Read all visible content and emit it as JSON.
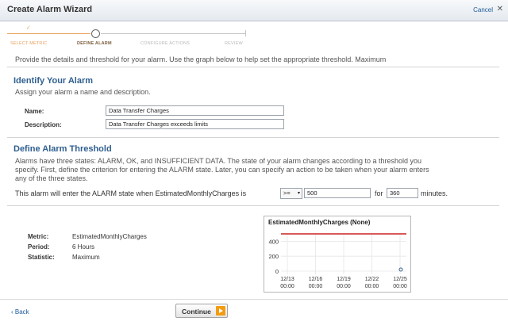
{
  "window": {
    "title": "Create Alarm Wizard",
    "cancel_label": "Cancel"
  },
  "steps": [
    {
      "label": "SELECT METRIC",
      "state": "done"
    },
    {
      "label": "DEFINE ALARM",
      "state": "active"
    },
    {
      "label": "CONFIGURE ACTIONS",
      "state": "pending"
    },
    {
      "label": "REVIEW",
      "state": "pending"
    }
  ],
  "intro": "Provide the details and threshold for your alarm. Use the graph below to help set the appropriate threshold. Maximum",
  "identify": {
    "title": "Identify Your Alarm",
    "desc": "Assign your alarm a name and description.",
    "name_label": "Name:",
    "name_value": "Data Transfer Charges",
    "description_label": "Description:",
    "description_value": "Data Transfer Charges exceeds limits"
  },
  "threshold": {
    "title": "Define Alarm Threshold",
    "desc_line1": "Alarms have three states: ALARM, OK, and INSUFFICIENT DATA. The state of your alarm changes according to a threshold you",
    "desc_line2": "specify. First, define the criterion for entering the ALARM state. Later, you can specify an action to be taken when your alarm enters",
    "desc_line3": "any of the three states.",
    "condition_text": "This alarm will enter the ALARM state when EstimatedMonthlyCharges is",
    "operator": ">=",
    "value": "500",
    "for_label": "for",
    "minutes_value": "360",
    "minutes_label": "minutes."
  },
  "stats": {
    "metric_label": "Metric:",
    "metric_value": "EstimatedMonthlyCharges",
    "period_label": "Period:",
    "period_value": "6 Hours",
    "statistic_label": "Statistic:",
    "statistic_value": "Maximum"
  },
  "chart_data": {
    "type": "line",
    "title": "EstimatedMonthlyCharges (None)",
    "x_ticks": [
      "12/13\n00:00",
      "12/16\n00:00",
      "12/19\n00:00",
      "12/22\n00:00",
      "12/25\n00:00"
    ],
    "y_ticks": [
      0,
      200,
      400
    ],
    "ylim": [
      0,
      500
    ],
    "threshold": 500,
    "threshold_color": "#cc2222",
    "series": [
      {
        "values": [
          0
        ]
      }
    ]
  },
  "footer": {
    "back_label": "‹ Back",
    "continue_label": "Continue"
  },
  "colors": {
    "accent": "#f39c12",
    "section_title": "#2f5f8f",
    "link": "#1a5a99"
  }
}
